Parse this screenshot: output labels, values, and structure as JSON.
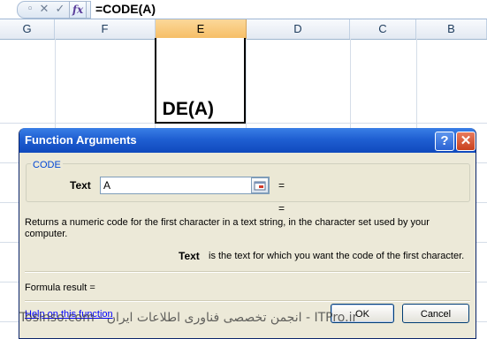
{
  "formula_bar": {
    "cancel_icon": "x-icon",
    "confirm_icon": "check-icon",
    "fx_label": "fx",
    "formula": "=CODE(A)"
  },
  "columns": [
    {
      "label": "G",
      "selected": false
    },
    {
      "label": "F",
      "selected": false
    },
    {
      "label": "E",
      "selected": true
    },
    {
      "label": "D",
      "selected": false
    },
    {
      "label": "C",
      "selected": false
    },
    {
      "label": "B",
      "selected": false
    }
  ],
  "active_cell": {
    "visible_text": "DE(A)"
  },
  "dialog": {
    "title": "Function Arguments",
    "help_button": "?",
    "close_button": "✕",
    "function_name": "CODE",
    "argument": {
      "label": "Text",
      "value": "A",
      "equals": "="
    },
    "result_equals": "=",
    "description": "Returns a numeric code for the first character in a text string, in the character set used by your computer.",
    "arg_description_name": "Text",
    "arg_description_text": "is the text for which you want the code of the first character.",
    "formula_result_label": "Formula result =",
    "help_link": "Help on this function",
    "ok_label": "OK",
    "cancel_label": "Cancel"
  },
  "watermark": "Tosinso.com - انجمن تخصصی فناوری اطلاعات ایران - ITPro.ir"
}
